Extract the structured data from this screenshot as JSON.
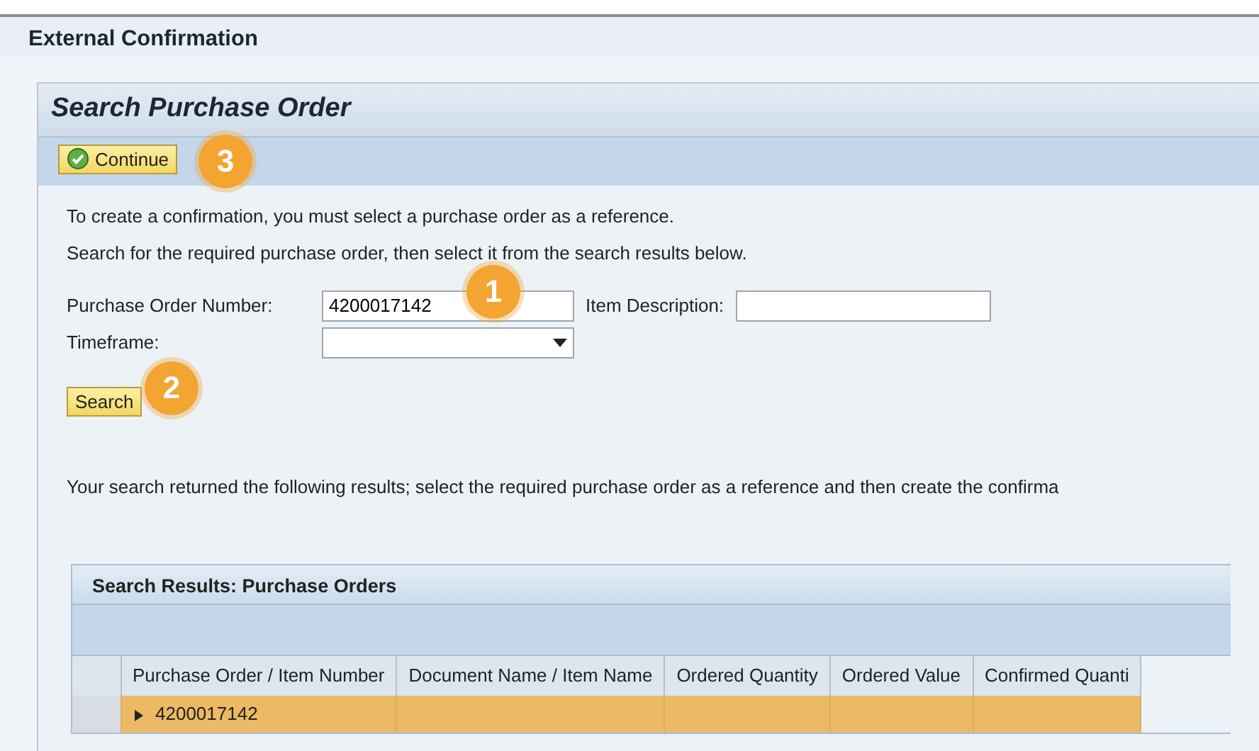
{
  "window": {
    "title": "External Confirmation"
  },
  "panel": {
    "title": "Search Purchase Order"
  },
  "toolbar": {
    "buttons": [
      {
        "label": "Continue",
        "callout": "3"
      }
    ]
  },
  "instructions": [
    "To create a confirmation, you must select a purchase order as a reference.",
    "Search for the required purchase order, then select it from the search results below."
  ],
  "form": {
    "po_number": {
      "label": "Purchase Order Number:",
      "value": "4200017142",
      "callout": "1"
    },
    "item_description": {
      "label": "Item Description:"
    },
    "timeframe": {
      "label": "Timeframe:"
    },
    "search_button": {
      "label": "Search",
      "callout": "2"
    }
  },
  "result_message": "Your search returned the following results; select the required purchase order as a reference and then create the confirma",
  "table": {
    "title": "Search Results: Purchase Orders",
    "columns": [
      "Purchase Order / Item Number",
      "Document Name / Item Name",
      "Ordered Quantity",
      "Ordered Value",
      "Confirmed Quanti"
    ],
    "rows": [
      {
        "cells": [
          "4200017142",
          "",
          "",
          "",
          ""
        ],
        "selected": true,
        "expanded": false
      }
    ]
  }
}
